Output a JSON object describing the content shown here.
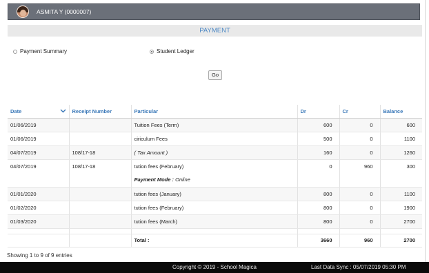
{
  "user": {
    "display": "ASMITA Y (0000007)"
  },
  "page_title": "PAYMENT",
  "options": {
    "payment_summary": "Payment Summary",
    "student_ledger": "Student Ledger",
    "selected": "student_ledger"
  },
  "go_label": "Go",
  "table": {
    "headers": [
      "Date",
      "Receipt Number",
      "Particular",
      "Dr",
      "Cr",
      "Balance"
    ],
    "rows": [
      {
        "date": "01/06/2019",
        "receipt": "",
        "particular": "Tuition Fees (Term)",
        "dr": "600",
        "cr": "0",
        "balance": "600"
      },
      {
        "date": "01/06/2019",
        "receipt": "",
        "particular": "ciriculum Fees",
        "dr": "500",
        "cr": "0",
        "balance": "1100"
      },
      {
        "date": "04/07/2019",
        "receipt": "108/17-18",
        "particular": "( Tax Amount )",
        "dr": "160",
        "cr": "0",
        "balance": "1260"
      },
      {
        "date": "04/07/2019",
        "receipt": "108/17-18",
        "particular": "tution fees (February)",
        "dr": "0",
        "cr": "960",
        "balance": "300"
      },
      {
        "date": "01/01/2020",
        "receipt": "",
        "particular": "tution fees (January)",
        "dr": "800",
        "cr": "0",
        "balance": "1100"
      },
      {
        "date": "01/02/2020",
        "receipt": "",
        "particular": "tution fees (February)",
        "dr": "800",
        "cr": "0",
        "balance": "1900"
      },
      {
        "date": "01/03/2020",
        "receipt": "",
        "particular": "tution fees (March)",
        "dr": "800",
        "cr": "0",
        "balance": "2700"
      }
    ],
    "payment_mode_label": "Payment Mode :",
    "payment_mode_value": "Online",
    "total": {
      "label": "Total :",
      "dr": "3660",
      "cr": "960",
      "balance": "2700"
    }
  },
  "entries_info": "Showing 1 to 9 of 9 entries",
  "footer": {
    "copyright": "Copyright © 2019 - School Magica",
    "last_sync": "Last Data Sync : 05/07/2019 05:30 PM"
  },
  "colors": {
    "header_blue": "#3a78b8",
    "userbar": "#6b7079",
    "footer": "#0b0b0b"
  },
  "icons": {
    "sort": "chevron-down-icon",
    "avatar": "user-avatar"
  }
}
